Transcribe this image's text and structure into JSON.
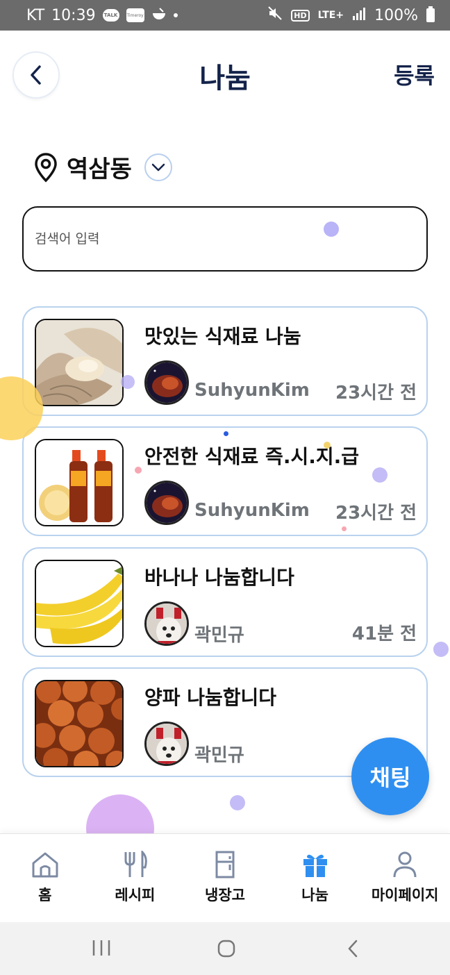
{
  "status_bar": {
    "carrier": "KT",
    "time": "10:39",
    "network": "LTE+",
    "battery": "100%",
    "hd": "HD",
    "app1": "TALK",
    "app2": "Timeroy"
  },
  "header": {
    "title": "나눔",
    "register_label": "등록"
  },
  "location": {
    "name": "역삼동"
  },
  "search": {
    "placeholder": "검색어 입력"
  },
  "posts": [
    {
      "title": "맛있는 식재료 나눔",
      "author": "SuhyunKim",
      "time": "23시간 전",
      "image": "scallops",
      "avatar": "nebula"
    },
    {
      "title": "안전한 식재료 즉.시.지.급",
      "author": "SuhyunKim",
      "time": "23시간 전",
      "image": "sauce-bottles",
      "avatar": "nebula"
    },
    {
      "title": "바나나 나눔합니다",
      "author": "곽민규",
      "time": "41분 전",
      "image": "bananas",
      "avatar": "dog"
    },
    {
      "title": "양파 나눔합니다",
      "author": "곽민규",
      "time": "",
      "image": "onions",
      "avatar": "dog"
    }
  ],
  "chat": {
    "label": "채팅"
  },
  "bottom_nav": [
    {
      "label": "홈",
      "icon": "home-icon"
    },
    {
      "label": "레시피",
      "icon": "fork-knife-icon"
    },
    {
      "label": "냉장고",
      "icon": "fridge-icon"
    },
    {
      "label": "나눔",
      "icon": "gift-icon",
      "active": true
    },
    {
      "label": "마이페이지",
      "icon": "person-icon"
    }
  ],
  "colors": {
    "navy": "#14234a",
    "accent": "#2f8ff0",
    "card_border": "#b9d2ee",
    "muted_text": "#6f7479"
  }
}
